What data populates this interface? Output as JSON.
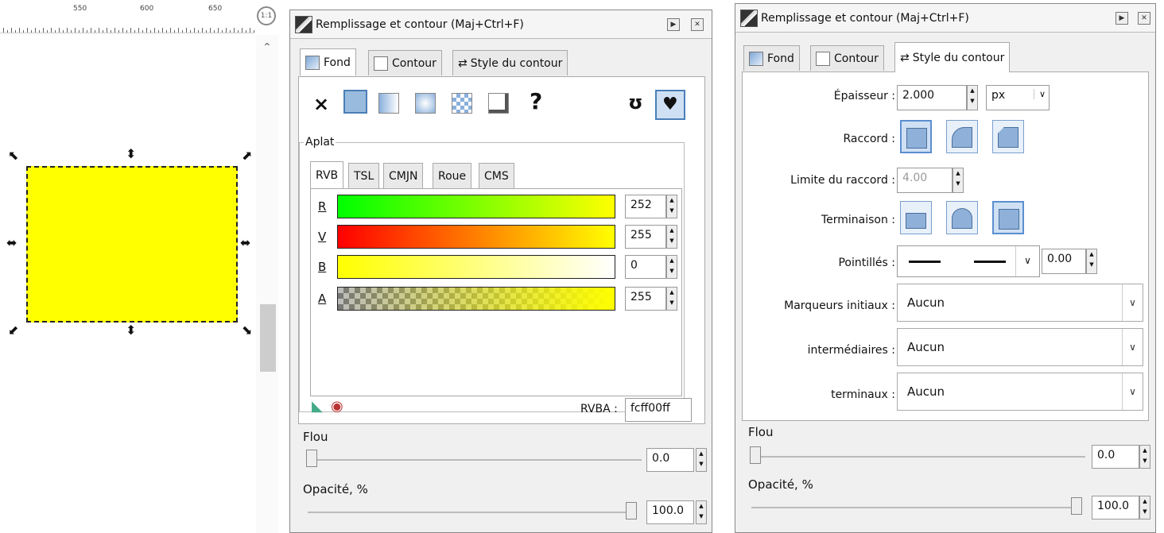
{
  "ruler": {
    "labels": [
      "550",
      "600",
      "650"
    ]
  },
  "panel1": {
    "title": "Remplissage et contour (Maj+Ctrl+F)",
    "tabs": [
      "Fond",
      "Contour",
      "Style du contour"
    ],
    "section": "Aplat",
    "color_tabs": [
      "RVB",
      "TSL",
      "CMJN",
      "Roue",
      "CMS"
    ],
    "rows": [
      {
        "label": "R",
        "value": "252"
      },
      {
        "label": "V",
        "value": "255"
      },
      {
        "label": "B",
        "value": "0"
      },
      {
        "label": "A",
        "value": "255"
      }
    ],
    "rvba_label": "RVBA :",
    "rvba_value": "fcff00ff",
    "flou_label": "Flou",
    "flou_value": "0.0",
    "opacity_label": "Opacité, %",
    "opacity_value": "100.0",
    "none_glyph": "×",
    "unknown_glyph": "?"
  },
  "panel2": {
    "title": "Remplissage et contour (Maj+Ctrl+F)",
    "tabs": [
      "Fond",
      "Contour",
      "Style du contour"
    ],
    "epaisseur_label": "Épaisseur :",
    "epaisseur_value": "2.000",
    "unit": "px",
    "raccord_label": "Raccord :",
    "limite_label": "Limite du raccord :",
    "limite_value": "4.00",
    "terminaison_label": "Terminaison :",
    "pointilles_label": "Pointillés :",
    "pointilles_value": "0.00",
    "marq_init_label": "Marqueurs initiaux :",
    "marq_init_value": "Aucun",
    "marq_inter_label": "intermédiaires :",
    "marq_inter_value": "Aucun",
    "marq_term_label": "terminaux :",
    "marq_term_value": "Aucun",
    "flou_label": "Flou",
    "flou_value": "0.0",
    "opacity_label": "Opacité, %",
    "opacity_value": "100.0"
  },
  "colors": {
    "fill": "#ffff00",
    "accent": "#4a7fb7"
  }
}
